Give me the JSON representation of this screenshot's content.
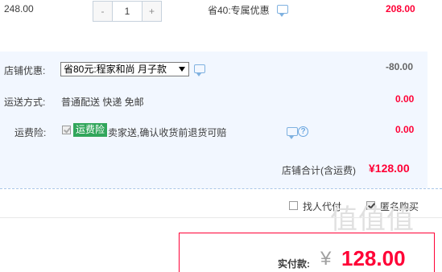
{
  "item": {
    "unit_price": "248.00",
    "quantity": "1",
    "minus_label": "-",
    "plus_label": "+",
    "promo_text": "省40:专属优惠",
    "row_total": "208.00"
  },
  "shop_discount": {
    "label": "店铺优惠:",
    "selected": "省80元:程家和尚 月子款",
    "amount": "-80.00"
  },
  "shipping": {
    "label": "运送方式:",
    "method": "普通配送 快递 免邮",
    "amount": "0.00"
  },
  "insurance": {
    "label": "运费险:",
    "tag": "运费险",
    "description": "卖家送,确认收货前退货可赔",
    "amount": "0.00"
  },
  "shop_total": {
    "label": "店铺合计(含运费)",
    "value": "¥128.00"
  },
  "options": {
    "proxy_pay_label": "找人代付",
    "anonymous_label": "匿名购买"
  },
  "payment": {
    "label": "实付款:",
    "currency": "¥",
    "value": "128.00"
  },
  "watermark": "值值值",
  "colors": {
    "accent_red": "#ff0036",
    "panel_bg": "#f2f7ff",
    "tag_green": "#31a65b"
  }
}
